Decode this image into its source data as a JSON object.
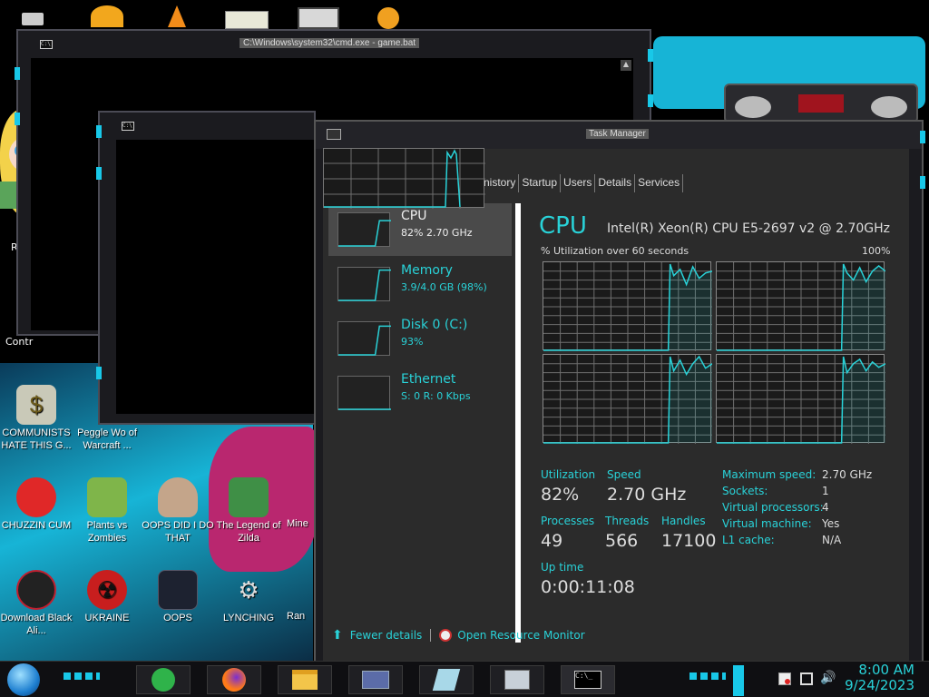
{
  "colors": {
    "accent": "#29d2d8",
    "frame_notch": "#18c8e8",
    "wallpaper_cyan": "#17b4d6"
  },
  "windows": {
    "cmd_back": {
      "title": "C:\\Windows\\system32\\cmd.exe - game.bat"
    },
    "task_manager": {
      "title": "Task Manager"
    }
  },
  "desktop_icons": [
    {
      "label": "COMMUNISTS HATE THIS G...",
      "icon": "money-bag-icon"
    },
    {
      "label": "Peggle Wo of Warcraft ...",
      "icon": "peggle-icon"
    },
    {
      "label": "CHUZZIN CUM",
      "icon": "chuzzle-icon"
    },
    {
      "label": "Plants vs Zombies",
      "icon": "plants-vs-zombies-icon"
    },
    {
      "label": "OOPS DID I DO THAT",
      "icon": "portrait-icon"
    },
    {
      "label": "The Legend of Zilda",
      "icon": "zelda-icon"
    },
    {
      "label": "Mine",
      "icon": "minecraft-icon"
    },
    {
      "label": "Download Black Ali...",
      "icon": "alienware-icon"
    },
    {
      "label": "UKRAINE",
      "icon": "radiation-icon"
    },
    {
      "label": "OOPS",
      "icon": "oops-icon"
    },
    {
      "label": "LYNCHING",
      "icon": "settings-gear-icon"
    },
    {
      "label": "Ran",
      "icon": "generic-icon"
    },
    {
      "label": "Re",
      "icon": "generic-icon"
    },
    {
      "label": "Contr",
      "icon": "generic-icon"
    }
  ],
  "tm": {
    "tabs": [
      "nistory",
      "Startup",
      "Users",
      "Details",
      "Services"
    ],
    "side": [
      {
        "name": "CPU",
        "sub": "82%  2.70 GHz",
        "spark_level": 0.82
      },
      {
        "name": "Memory",
        "sub": "3.9/4.0 GB (98%)",
        "spark_level": 0.98
      },
      {
        "name": "Disk 0 (C:)",
        "sub": "93%",
        "spark_level": 0.93
      },
      {
        "name": "Ethernet",
        "sub": "S: 0  R: 0 Kbps",
        "spark_level": 0.0
      }
    ],
    "heading": "CPU",
    "model": "Intel(R) Xeon(R) CPU E5-2697 v2 @ 2.70GHz",
    "util_label": "% Utilization over 60 seconds",
    "util_max": "100%",
    "stats": {
      "utilization_label": "Utilization",
      "utilization": "82%",
      "speed_label": "Speed",
      "speed": "2.70 GHz",
      "processes_label": "Processes",
      "processes": "49",
      "threads_label": "Threads",
      "threads": "566",
      "handles_label": "Handles",
      "handles": "17100",
      "uptime_label": "Up time",
      "uptime": "0:00:11:08"
    },
    "details": [
      {
        "k": "Maximum speed:",
        "v": "2.70 GHz"
      },
      {
        "k": "Sockets:",
        "v": "1"
      },
      {
        "k": "Virtual processors:",
        "v": "4"
      },
      {
        "k": "Virtual machine:",
        "v": "Yes"
      },
      {
        "k": "L1 cache:",
        "v": "N/A"
      }
    ],
    "footer": {
      "fewer": "Fewer details",
      "monitor": "Open Resource Monitor"
    }
  },
  "taskbar": {
    "time": "8:00 AM",
    "date": "9/24/2023",
    "apps": [
      "start-orb-icon",
      "sticky-notes-icon",
      "firefox-icon",
      "file-explorer-icon",
      "id-card-icon",
      "notepad-icon",
      "task-manager-icon",
      "cmd-icon"
    ]
  }
}
